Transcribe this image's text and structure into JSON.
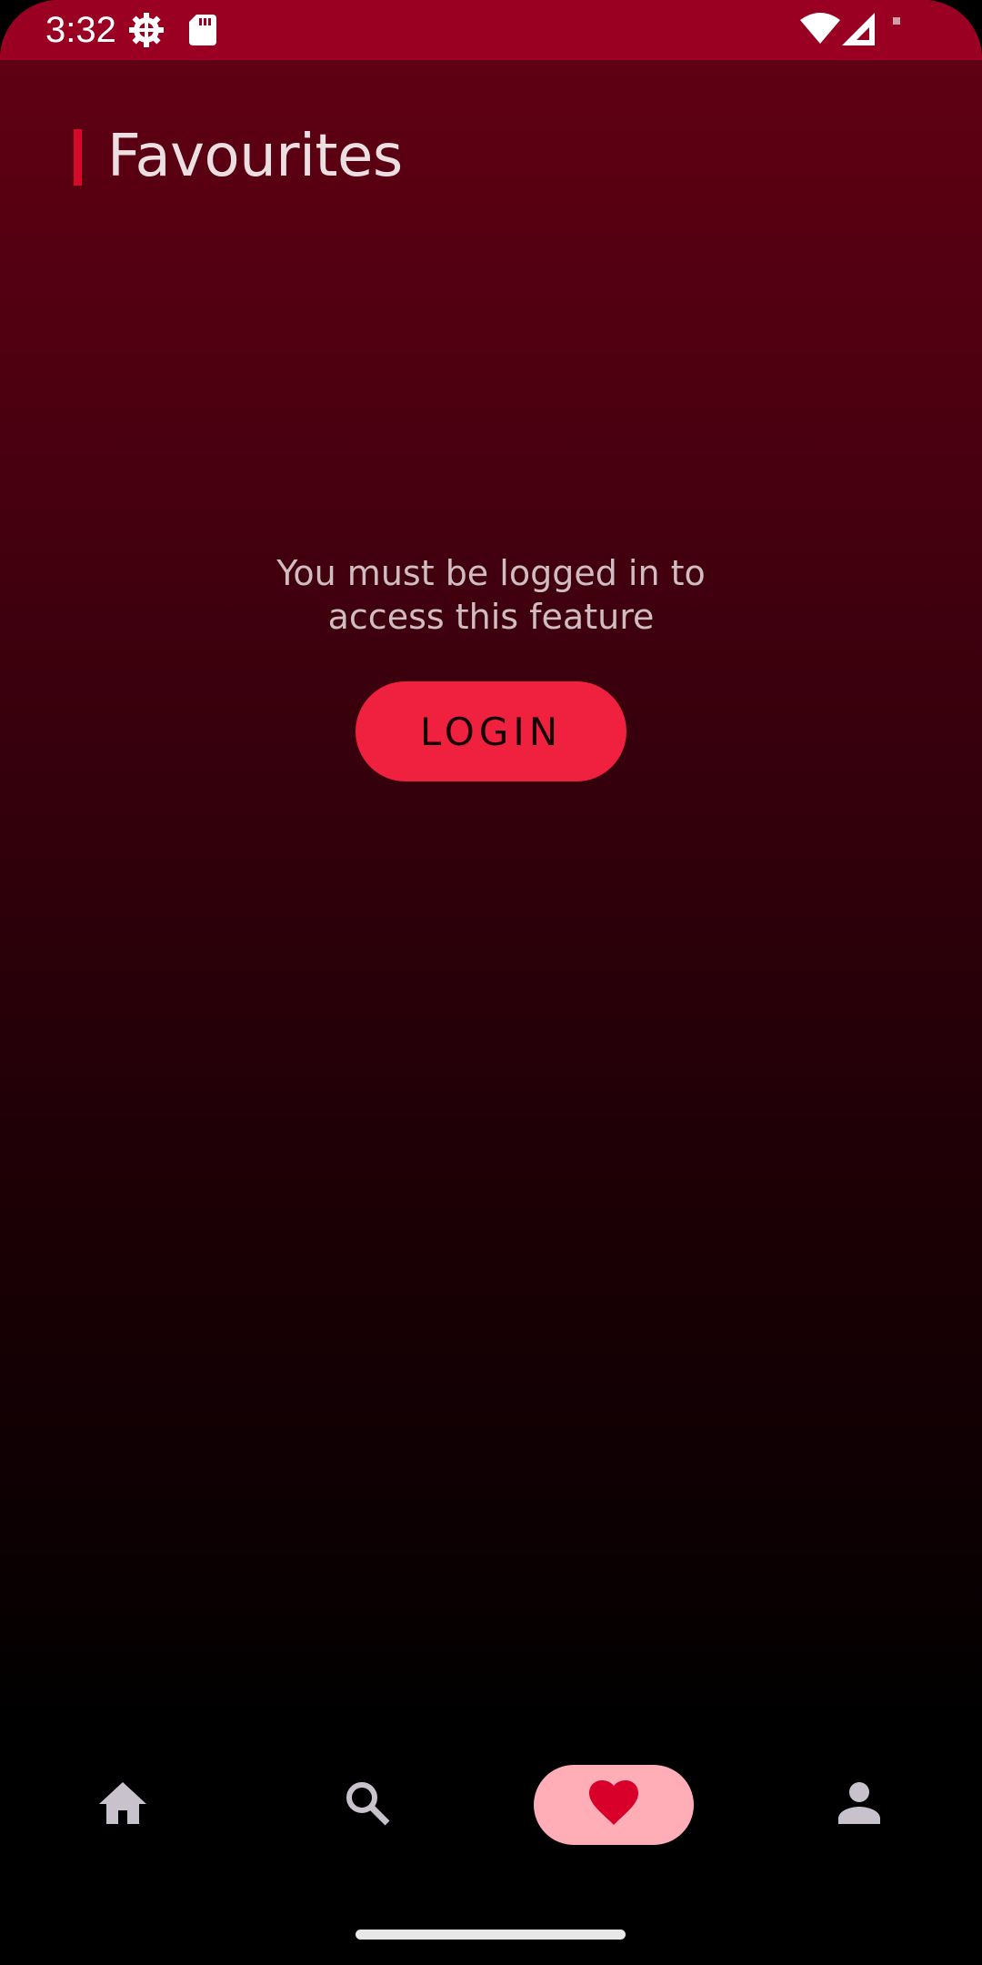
{
  "status_bar": {
    "time": "3:32",
    "icons": [
      "settings-gear-icon",
      "sd-card-icon",
      "wifi-icon",
      "cell-signal-icon",
      "battery-icon"
    ],
    "background_color": "#9a0021"
  },
  "header": {
    "title": "Favourites",
    "accent_color": "#d50a2a"
  },
  "main": {
    "message": "You must be logged in to access this feature",
    "login_label": "LOGIN",
    "login_color": "#ef213f"
  },
  "bottom_nav": {
    "items": [
      {
        "icon": "home-icon",
        "active": false
      },
      {
        "icon": "search-icon",
        "active": false
      },
      {
        "icon": "heart-icon",
        "active": true
      },
      {
        "icon": "person-icon",
        "active": false
      }
    ],
    "active_pill_color": "#ffadb6",
    "active_icon_color": "#d8002a",
    "inactive_icon_color": "#c8c2cc"
  }
}
